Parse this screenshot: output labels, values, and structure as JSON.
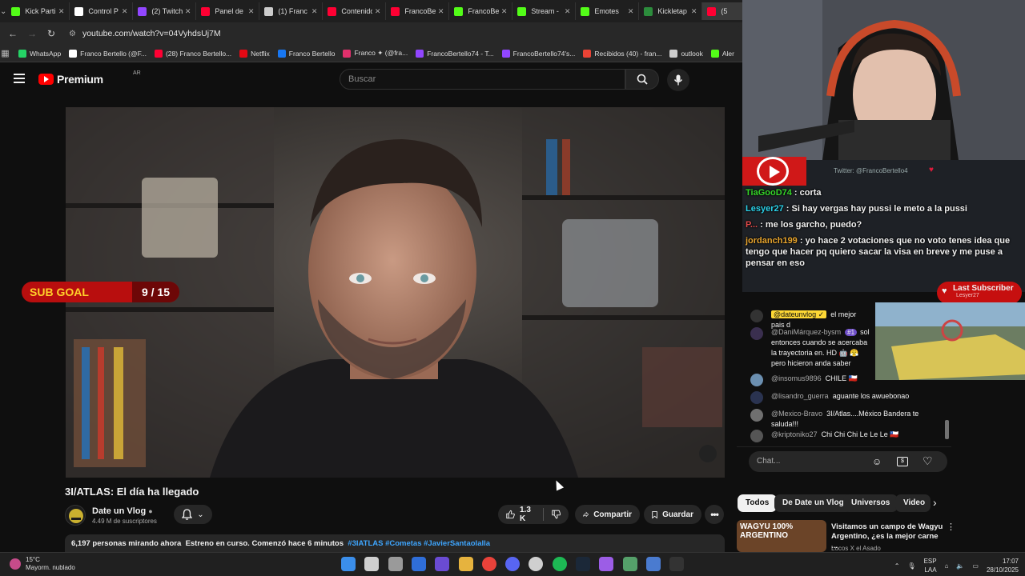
{
  "browser": {
    "tabs": [
      {
        "label": "Kick Parti",
        "color": "#53fc18"
      },
      {
        "label": "Control P",
        "color": "#ffffff"
      },
      {
        "label": "(2) Twitch",
        "color": "#9146ff"
      },
      {
        "label": "Panel de",
        "color": "#ff0033"
      },
      {
        "label": "(1) Franc",
        "color": "#cccccc"
      },
      {
        "label": "Contenido",
        "color": "#ff0033"
      },
      {
        "label": "FrancoBe",
        "color": "#ff0033"
      },
      {
        "label": "FrancoBe",
        "color": "#53fc18"
      },
      {
        "label": "Stream -",
        "color": "#53fc18"
      },
      {
        "label": "Emotes",
        "color": "#53fc18"
      },
      {
        "label": "Kickletap",
        "color": "#2c8c3c"
      },
      {
        "label": "(5",
        "color": "#ff0033"
      }
    ],
    "url": "youtube.com/watch?v=04VyhdsUj7M",
    "bookmarks": [
      {
        "label": "WhatsApp",
        "color": "#25d366"
      },
      {
        "label": "Franco Bertello (@F...",
        "color": "#ffffff"
      },
      {
        "label": "(28) Franco Bertello...",
        "color": "#ff0033"
      },
      {
        "label": "Netflix",
        "color": "#e50914"
      },
      {
        "label": "Franco Bertello",
        "color": "#1877f2"
      },
      {
        "label": "Franco ✦ (@fra...",
        "color": "#e1306c"
      },
      {
        "label": "FrancoBertello74 - T...",
        "color": "#9146ff"
      },
      {
        "label": "FrancoBertello74's...",
        "color": "#9146ff"
      },
      {
        "label": "Recibidos (40) - fran...",
        "color": "#ea4335"
      },
      {
        "label": "outlook",
        "color": "#cccccc"
      },
      {
        "label": "Aler",
        "color": "#53fc18"
      }
    ]
  },
  "youtube": {
    "logo_text": "Premium",
    "country": "AR",
    "search_placeholder": "Buscar",
    "video_title": "3I/ATLAS: El día ha llegado",
    "channel_name": "Date un Vlog",
    "subscribers": "4.49 M de suscriptores",
    "likes": "1.3 K",
    "share_label": "Compartir",
    "save_label": "Guardar",
    "desc_viewers": "6,197 personas mirando ahora",
    "desc_status": "Estreno en curso. Comenzó hace 6 minutos",
    "desc_tags": "#3IATLAS #Cometas #JavierSantaolalla"
  },
  "overlay": {
    "twitter": "Twitter: @FrancoBertello4",
    "chat": [
      {
        "user": "TiaGooD74",
        "text": "corta",
        "color": "#35d629"
      },
      {
        "user": "Lesyer27",
        "text": "Si hay vergas hay pussi le meto a la pussi",
        "color": "#2bd0e8"
      },
      {
        "user": "P...",
        "text": "me los garcho, puedo?",
        "color": "#e24b4b"
      },
      {
        "user": "jordanch199",
        "text": "yo hace 2 votaciones que no voto tenes idea que tengo que hacer pq quiero sacar la visa en breve y me puse a pensar en eso",
        "color": "#e8a52e"
      }
    ],
    "sub_goal_label": "SUB GOAL",
    "sub_goal_count": "9 / 15",
    "sub_goal_current": 9,
    "sub_goal_target": 15,
    "last_sub_label": "Last Subscriber",
    "last_sub_name": "Lesyer27"
  },
  "live_chat": {
    "messages": [
      {
        "author": "@dateunvlog ✓",
        "text": "el mejor pais d",
        "own": true
      },
      {
        "author": "@DaniMárquez-bysm",
        "text": "sol entonces cuando se acercaba la trayectoria en. HD 🤖 😤 pero hicieron anda saber",
        "own": false
      },
      {
        "author": "@insomus9896",
        "text": "CHILE 🇨🇱",
        "own": false
      },
      {
        "author": "@lisandro_guerra",
        "text": "aguante los awuebonao",
        "own": false
      },
      {
        "author": "@Mexico-Bravo",
        "text": "3I/Atlas....México Bandera te saluda!!!",
        "own": false
      },
      {
        "author": "@kriptoniko27",
        "text": "Chi Chi Chi Le Le Le 🇨🇱",
        "own": false
      }
    ],
    "badge": "#1",
    "input_placeholder": "Chat..."
  },
  "chips": [
    "Todos",
    "De Date un Vlog",
    "Universos",
    "Video"
  ],
  "recommended": {
    "thumb_text": "WAGYU 100% ARGENTINO",
    "title": "Visitamos un campo de Wagyu Argentino, ¿es la mejor carne ...",
    "channel": "Locos X el Asado"
  },
  "taskbar": {
    "temp": "15°C",
    "weather": "Mayorm. nublado",
    "lang1": "ESP",
    "lang2": "LAA",
    "time": "17:07",
    "date": "28/10/2025"
  }
}
